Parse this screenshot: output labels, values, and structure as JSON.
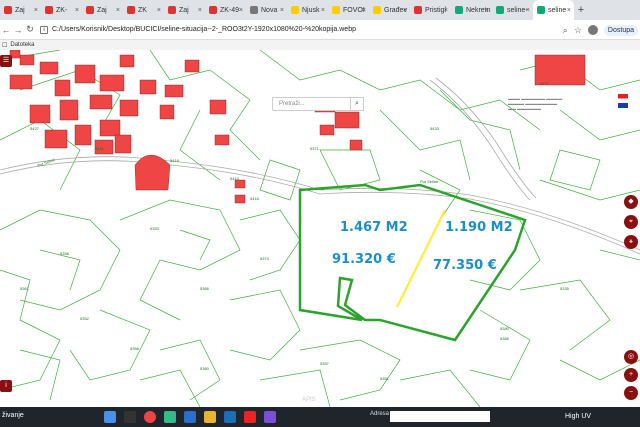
{
  "browser": {
    "tabs": [
      {
        "label": "Zaj",
        "color": "#d33"
      },
      {
        "label": "ZK-",
        "color": "#d33"
      },
      {
        "label": "Zaj",
        "color": "#d33"
      },
      {
        "label": "ZK",
        "color": "#d33"
      },
      {
        "label": "Zaj",
        "color": "#d33"
      },
      {
        "label": "ZK-49",
        "color": "#d33"
      },
      {
        "label": "Nova",
        "color": "#777"
      },
      {
        "label": "Njusk",
        "color": "#fc0"
      },
      {
        "label": "FOVOI",
        "color": "#fc0"
      },
      {
        "label": "Građev",
        "color": "#fc0"
      },
      {
        "label": "Pristigl",
        "color": "#d33"
      },
      {
        "label": "Nekretn",
        "color": "#1a7"
      },
      {
        "label": "seline-",
        "color": "#1a7"
      },
      {
        "label": "seline",
        "color": "#1a7"
      }
    ],
    "new_tab": "+",
    "url": "C:/Users/Korisnik/Desktop/BUCICI/seline-situacija--2-_ROO3t2Y-1920x1080%20-%20kopija.webp",
    "file_label": "Datoteka",
    "profile_status": "Dostupa"
  },
  "map": {
    "search_placeholder": "Pretraži...",
    "search_icon": "search-icon",
    "areas": [
      {
        "area": "1.467 M2",
        "price": "91.320 €"
      },
      {
        "area": "1.190 M2",
        "price": "77.350 €"
      }
    ],
    "street_label_1": "Put Seline",
    "street_label_2": "Put Seline",
    "accent_green": "#2aa52a",
    "divider_yellow": "#ffee33",
    "text_blue": "#1a8fcf"
  },
  "taskbar": {
    "left_text": "živanje",
    "address_label": "Adresa",
    "weather": "High UV",
    "apis_label": "APIS"
  }
}
